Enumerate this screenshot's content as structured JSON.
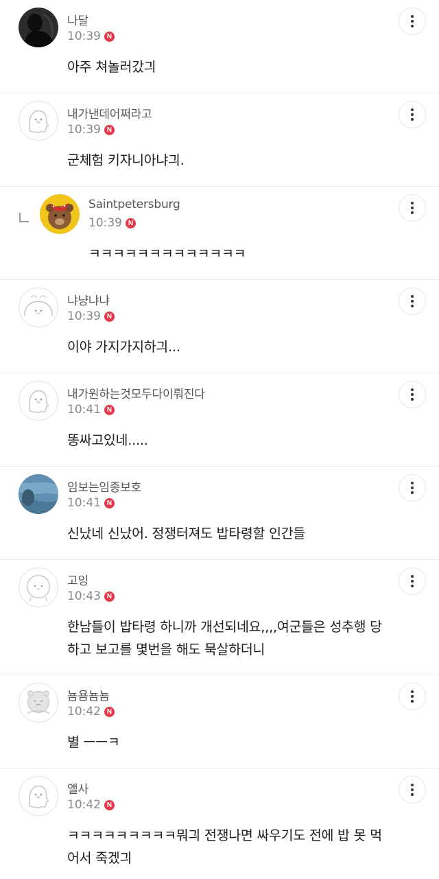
{
  "badge": {
    "label": "N",
    "color": "#e23a48"
  },
  "comments": [
    {
      "username": "나달",
      "time": "10:39",
      "text": "아주 쳐놀러갔긔",
      "avatar": "dark-silhouette-photo",
      "reply": false
    },
    {
      "username": "내가낸데어쩌라고",
      "time": "10:39",
      "text": "군체험 키자니아냐긔.",
      "avatar": "ghost-character-icon",
      "reply": false
    },
    {
      "username": "Saintpetersburg",
      "time": "10:39",
      "text": "ㅋㅋㅋㅋㅋㅋㅋㅋㅋㅋㅋㅋㅋ",
      "avatar": "teddy-bear-photo",
      "reply": true
    },
    {
      "username": "냐냥냐냐",
      "time": "10:39",
      "text": "이야 가지가지하긔...",
      "avatar": "round-bun-character-icon",
      "reply": false
    },
    {
      "username": "내가원하는것모두다이뤄진다",
      "time": "10:41",
      "text": "똥싸고있네.....",
      "avatar": "ghost-character-icon",
      "reply": false
    },
    {
      "username": "임보는임종보호",
      "time": "10:41",
      "text": "신났네 신났어. 정쟁터져도 밥타령할 인간들",
      "avatar": "blue-fabric-photo",
      "reply": false
    },
    {
      "username": "고잉",
      "time": "10:43",
      "text": "한남들이 밥타령 하니까 개선되네요,,,,여군들은 성추행 당하고 보고를 몇번을 해도 묵살하더니",
      "avatar": "round-face-character-icon",
      "reply": false
    },
    {
      "username": "뇸욤뇸뇸",
      "time": "10:42",
      "text": "별 ㅡㅡㅋ",
      "avatar": "sad-bear-character-icon",
      "reply": false
    },
    {
      "username": "앨사",
      "time": "10:42",
      "text": "ㅋㅋㅋㅋㅋㅋㅋㅋㅋ뭐긔 전쟁나면 싸우기도 전에 밥 못 먹어서 죽겠긔",
      "avatar": "ghost-character-icon",
      "reply": false
    }
  ]
}
